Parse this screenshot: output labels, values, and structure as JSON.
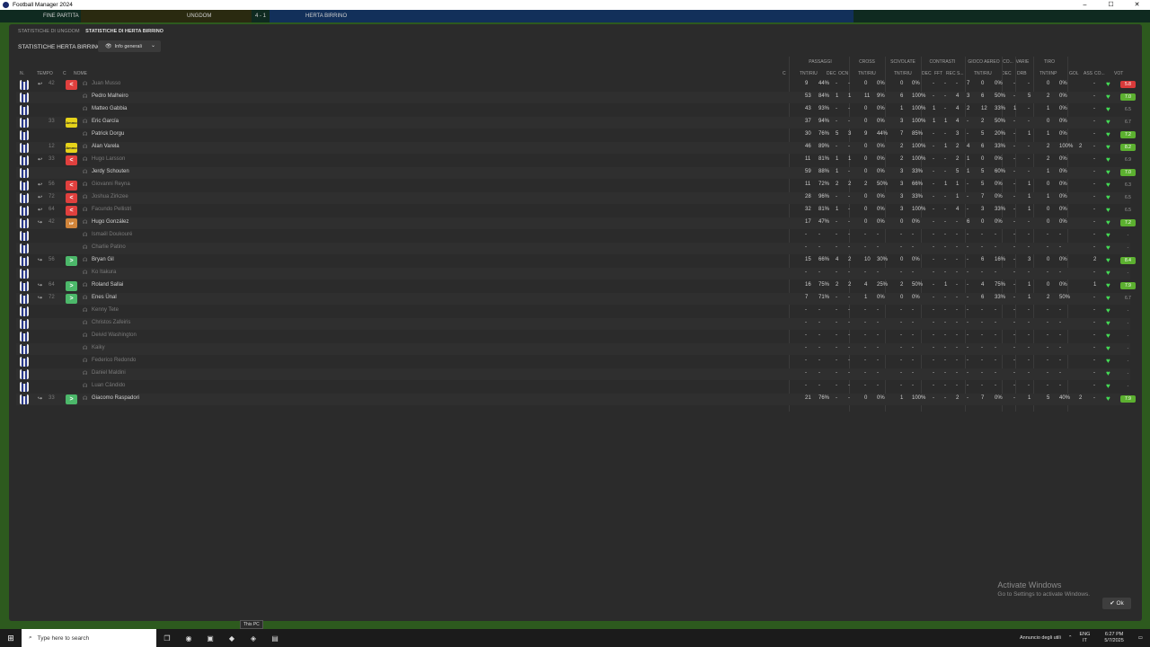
{
  "window": {
    "title": "Football Manager 2024",
    "controls": [
      "–",
      "☐",
      "✕"
    ]
  },
  "gamebar": {
    "status": "FINE PARTITA",
    "home": "UNGDOM",
    "score": "4 - 1",
    "away": "HERTA BIRRINO"
  },
  "breadcrumb": {
    "home_stats": "STATISTICHE DI UNGDOM",
    "away_stats": "STATISTICHE DI HERTA BIRRINO"
  },
  "panel_title": "STATISTICHE HERTA BIRRINO",
  "view_select": {
    "value": "Info generali",
    "icon": "eye-icon"
  },
  "group_headers": [
    "PASSAGGI",
    "CROSS",
    "SCIVOLATE",
    "CONTRASTI",
    "GIOCO AEREO",
    "CO...",
    "VARIE",
    "TIRO"
  ],
  "column_headers": {
    "num": "N.",
    "time": "TEMPO",
    "c": "C",
    "name": "NOME",
    "c2": "C",
    "pass_tnt": "TNT/RIU",
    "pass_dec": "DEC",
    "pass_ocn": "OCN",
    "cross": "TNT/RIU",
    "sciv": "TNT/RIU",
    "contr_dec": "DEC",
    "contr_fft": "FFT",
    "contr_rec": "REC",
    "contr_s": "S...",
    "aereo": "TNT/RIU",
    "co_dec": "DEC",
    "varie": "DRB",
    "tiro": "TNT/INP",
    "gol": "GOL",
    "ass": "ASS",
    "cond": "CO...",
    "vot": "VOT"
  },
  "players": [
    {
      "name": "Juan Musso",
      "time": "42",
      "sub": "↩",
      "pos": "<",
      "posc": "red",
      "p1": "9",
      "p2": "44%",
      "p3": "-",
      "p4": "-",
      "c1": "0",
      "c2": "0%",
      "s1": "0",
      "s2": "0%",
      "t1": "-",
      "t2": "-",
      "t3": "-",
      "t4": "7",
      "a1": "0",
      "a2": "0%",
      "d": "-",
      "v": "-",
      "ti1": "0",
      "ti2": "0%",
      "g": "",
      "as": "-",
      "vot": "5.8",
      "votc": "#d93a3a",
      "dim": true
    },
    {
      "name": "Pedro Malheiro",
      "time": "",
      "sub": "",
      "pos": "",
      "posc": "",
      "p1": "53",
      "p2": "84%",
      "p3": "1",
      "p4": "1",
      "c1": "11",
      "c2": "9%",
      "s1": "6",
      "s2": "100%",
      "t1": "-",
      "t2": "-",
      "t3": "4",
      "t4": "3",
      "a1": "6",
      "a2": "50%",
      "d": "-",
      "v": "5",
      "ti1": "2",
      "ti2": "0%",
      "g": "",
      "as": "-",
      "vot": "7.0",
      "votc": "#5cb030",
      "dim": false
    },
    {
      "name": "Matteo Gabbia",
      "time": "",
      "sub": "",
      "pos": "",
      "posc": "",
      "p1": "43",
      "p2": "93%",
      "p3": "-",
      "p4": "-",
      "c1": "0",
      "c2": "0%",
      "s1": "1",
      "s2": "100%",
      "t1": "1",
      "t2": "-",
      "t3": "4",
      "t4": "2",
      "a1": "12",
      "a2": "33%",
      "d": "1",
      "v": "-",
      "ti1": "1",
      "ti2": "0%",
      "g": "",
      "as": "-",
      "vot": "6.5",
      "votc": "",
      "dim": false
    },
    {
      "name": "Eric García",
      "time": "33",
      "sub": "",
      "pos": "Ammo",
      "posc": "ylw",
      "p1": "37",
      "p2": "94%",
      "p3": "-",
      "p4": "-",
      "c1": "0",
      "c2": "0%",
      "s1": "3",
      "s2": "100%",
      "t1": "1",
      "t2": "1",
      "t3": "4",
      "t4": "-",
      "a1": "2",
      "a2": "50%",
      "d": "-",
      "v": "-",
      "ti1": "0",
      "ti2": "0%",
      "g": "",
      "as": "-",
      "vot": "6.7",
      "votc": "",
      "dim": false
    },
    {
      "name": "Patrick Dorgu",
      "time": "",
      "sub": "",
      "pos": "",
      "posc": "",
      "p1": "30",
      "p2": "76%",
      "p3": "5",
      "p4": "3",
      "c1": "9",
      "c2": "44%",
      "s1": "7",
      "s2": "85%",
      "t1": "-",
      "t2": "-",
      "t3": "3",
      "t4": "-",
      "a1": "5",
      "a2": "20%",
      "d": "-",
      "v": "1",
      "ti1": "1",
      "ti2": "0%",
      "g": "",
      "as": "-",
      "vot": "7.2",
      "votc": "#5cb030",
      "dim": false
    },
    {
      "name": "Alan Varela",
      "time": "12",
      "sub": "",
      "pos": "Ammo",
      "posc": "ylw",
      "p1": "46",
      "p2": "89%",
      "p3": "-",
      "p4": "-",
      "c1": "0",
      "c2": "0%",
      "s1": "2",
      "s2": "100%",
      "t1": "-",
      "t2": "1",
      "t3": "2",
      "t4": "4",
      "a1": "6",
      "a2": "33%",
      "d": "-",
      "v": "-",
      "ti1": "2",
      "ti2": "100%",
      "g": "2",
      "as": "-",
      "vot": "8.2",
      "votc": "#5cb030",
      "dim": false
    },
    {
      "name": "Hugo Larsson",
      "time": "33",
      "sub": "↩",
      "pos": "<",
      "posc": "red",
      "p1": "11",
      "p2": "81%",
      "p3": "1",
      "p4": "1",
      "c1": "0",
      "c2": "0%",
      "s1": "2",
      "s2": "100%",
      "t1": "-",
      "t2": "-",
      "t3": "2",
      "t4": "1",
      "a1": "0",
      "a2": "0%",
      "d": "-",
      "v": "-",
      "ti1": "2",
      "ti2": "0%",
      "g": "",
      "as": "-",
      "vot": "6.9",
      "votc": "",
      "dim": true
    },
    {
      "name": "Jerdy Schouten",
      "time": "",
      "sub": "",
      "pos": "",
      "posc": "",
      "p1": "59",
      "p2": "88%",
      "p3": "1",
      "p4": "-",
      "c1": "0",
      "c2": "0%",
      "s1": "3",
      "s2": "33%",
      "t1": "-",
      "t2": "-",
      "t3": "5",
      "t4": "1",
      "a1": "5",
      "a2": "60%",
      "d": "-",
      "v": "-",
      "ti1": "1",
      "ti2": "0%",
      "g": "",
      "as": "-",
      "vot": "7.0",
      "votc": "#5cb030",
      "dim": false
    },
    {
      "name": "Giovanni Reyna",
      "time": "56",
      "sub": "↩",
      "pos": "<",
      "posc": "red",
      "p1": "11",
      "p2": "72%",
      "p3": "2",
      "p4": "2",
      "c1": "2",
      "c2": "50%",
      "s1": "3",
      "s2": "66%",
      "t1": "-",
      "t2": "1",
      "t3": "1",
      "t4": "-",
      "a1": "5",
      "a2": "0%",
      "d": "-",
      "v": "1",
      "ti1": "0",
      "ti2": "0%",
      "g": "",
      "as": "-",
      "vot": "6.3",
      "votc": "",
      "dim": true
    },
    {
      "name": "Joshua Zirkzee",
      "time": "72",
      "sub": "↩",
      "pos": "<",
      "posc": "red",
      "p1": "28",
      "p2": "96%",
      "p3": "-",
      "p4": "-",
      "c1": "0",
      "c2": "0%",
      "s1": "3",
      "s2": "33%",
      "t1": "-",
      "t2": "-",
      "t3": "1",
      "t4": "-",
      "a1": "7",
      "a2": "0%",
      "d": "-",
      "v": "1",
      "ti1": "1",
      "ti2": "0%",
      "g": "",
      "as": "-",
      "vot": "6.5",
      "votc": "",
      "dim": true
    },
    {
      "name": "Facundo Pellistri",
      "time": "64",
      "sub": "↩",
      "pos": "<",
      "posc": "red",
      "p1": "32",
      "p2": "81%",
      "p3": "1",
      "p4": "-",
      "c1": "0",
      "c2": "0%",
      "s1": "3",
      "s2": "100%",
      "t1": "-",
      "t2": "-",
      "t3": "4",
      "t4": "-",
      "a1": "3",
      "a2": "33%",
      "d": "-",
      "v": "1",
      "ti1": "0",
      "ti2": "0%",
      "g": "",
      "as": "-",
      "vot": "6.5",
      "votc": "",
      "dim": true
    },
    {
      "name": "Hugo González",
      "time": "42",
      "sub": "↪",
      "pos": "NF",
      "posc": "org",
      "p1": "17",
      "p2": "47%",
      "p3": "-",
      "p4": "-",
      "c1": "0",
      "c2": "0%",
      "s1": "0",
      "s2": "0%",
      "t1": "-",
      "t2": "-",
      "t3": "-",
      "t4": "6",
      "a1": "0",
      "a2": "0%",
      "d": "-",
      "v": "-",
      "ti1": "0",
      "ti2": "0%",
      "g": "",
      "as": "-",
      "vot": "7.2",
      "votc": "#5cb030",
      "dim": false
    },
    {
      "name": "Ismaël Doukouré",
      "time": "",
      "sub": "",
      "pos": "",
      "posc": "",
      "p1": "-",
      "p2": "-",
      "p3": "-",
      "p4": "-",
      "c1": "-",
      "c2": "-",
      "s1": "-",
      "s2": "-",
      "t1": "-",
      "t2": "-",
      "t3": "-",
      "t4": "-",
      "a1": "-",
      "a2": "-",
      "d": "-",
      "v": "-",
      "ti1": "-",
      "ti2": "-",
      "g": "",
      "as": "-",
      "vot": "-",
      "votc": "",
      "dim": true
    },
    {
      "name": "Charlie Patino",
      "time": "",
      "sub": "",
      "pos": "",
      "posc": "",
      "p1": "-",
      "p2": "-",
      "p3": "-",
      "p4": "-",
      "c1": "-",
      "c2": "-",
      "s1": "-",
      "s2": "-",
      "t1": "-",
      "t2": "-",
      "t3": "-",
      "t4": "-",
      "a1": "-",
      "a2": "-",
      "d": "-",
      "v": "-",
      "ti1": "-",
      "ti2": "-",
      "g": "",
      "as": "-",
      "vot": "-",
      "votc": "",
      "dim": true
    },
    {
      "name": "Bryan Gil",
      "time": "56",
      "sub": "↪",
      "pos": ">",
      "posc": "grn",
      "p1": "15",
      "p2": "66%",
      "p3": "4",
      "p4": "2",
      "c1": "10",
      "c2": "30%",
      "s1": "0",
      "s2": "0%",
      "t1": "-",
      "t2": "-",
      "t3": "-",
      "t4": "-",
      "a1": "6",
      "a2": "16%",
      "d": "-",
      "v": "3",
      "ti1": "0",
      "ti2": "0%",
      "g": "",
      "as": "2",
      "vot": "8.4",
      "votc": "#5cb030",
      "dim": false
    },
    {
      "name": "Ko Itakura",
      "time": "",
      "sub": "",
      "pos": "",
      "posc": "",
      "p1": "-",
      "p2": "-",
      "p3": "-",
      "p4": "-",
      "c1": "-",
      "c2": "-",
      "s1": "-",
      "s2": "-",
      "t1": "-",
      "t2": "-",
      "t3": "-",
      "t4": "-",
      "a1": "-",
      "a2": "-",
      "d": "-",
      "v": "-",
      "ti1": "-",
      "ti2": "-",
      "g": "",
      "as": "-",
      "vot": "-",
      "votc": "",
      "dim": true
    },
    {
      "name": "Roland Sallai",
      "time": "64",
      "sub": "↪",
      "pos": ">",
      "posc": "grn",
      "p1": "16",
      "p2": "75%",
      "p3": "2",
      "p4": "2",
      "c1": "4",
      "c2": "25%",
      "s1": "2",
      "s2": "50%",
      "t1": "-",
      "t2": "1",
      "t3": "-",
      "t4": "-",
      "a1": "4",
      "a2": "75%",
      "d": "-",
      "v": "1",
      "ti1": "0",
      "ti2": "0%",
      "g": "",
      "as": "1",
      "vot": "7.9",
      "votc": "#5cb030",
      "dim": false
    },
    {
      "name": "Enes Ünal",
      "time": "72",
      "sub": "↪",
      "pos": ">",
      "posc": "grn",
      "p1": "7",
      "p2": "71%",
      "p3": "-",
      "p4": "-",
      "c1": "1",
      "c2": "0%",
      "s1": "0",
      "s2": "0%",
      "t1": "-",
      "t2": "-",
      "t3": "-",
      "t4": "-",
      "a1": "6",
      "a2": "33%",
      "d": "-",
      "v": "1",
      "ti1": "2",
      "ti2": "50%",
      "g": "",
      "as": "-",
      "vot": "6.7",
      "votc": "",
      "dim": false
    },
    {
      "name": "Kenny Tete",
      "time": "",
      "sub": "",
      "pos": "",
      "posc": "",
      "p1": "-",
      "p2": "-",
      "p3": "-",
      "p4": "-",
      "c1": "-",
      "c2": "-",
      "s1": "-",
      "s2": "-",
      "t1": "-",
      "t2": "-",
      "t3": "-",
      "t4": "-",
      "a1": "-",
      "a2": "-",
      "d": "-",
      "v": "-",
      "ti1": "-",
      "ti2": "-",
      "g": "",
      "as": "-",
      "vot": "-",
      "votc": "",
      "dim": true
    },
    {
      "name": "Christos Zafeiris",
      "time": "",
      "sub": "",
      "pos": "",
      "posc": "",
      "p1": "-",
      "p2": "-",
      "p3": "-",
      "p4": "-",
      "c1": "-",
      "c2": "-",
      "s1": "-",
      "s2": "-",
      "t1": "-",
      "t2": "-",
      "t3": "-",
      "t4": "-",
      "a1": "-",
      "a2": "-",
      "d": "-",
      "v": "-",
      "ti1": "-",
      "ti2": "-",
      "g": "",
      "as": "-",
      "vot": "-",
      "votc": "",
      "dim": true
    },
    {
      "name": "Deivid Washington",
      "time": "",
      "sub": "",
      "pos": "",
      "posc": "",
      "p1": "-",
      "p2": "-",
      "p3": "-",
      "p4": "-",
      "c1": "-",
      "c2": "-",
      "s1": "-",
      "s2": "-",
      "t1": "-",
      "t2": "-",
      "t3": "-",
      "t4": "-",
      "a1": "-",
      "a2": "-",
      "d": "-",
      "v": "-",
      "ti1": "-",
      "ti2": "-",
      "g": "",
      "as": "-",
      "vot": "-",
      "votc": "",
      "dim": true
    },
    {
      "name": "Kaiky",
      "time": "",
      "sub": "",
      "pos": "",
      "posc": "",
      "p1": "-",
      "p2": "-",
      "p3": "-",
      "p4": "-",
      "c1": "-",
      "c2": "-",
      "s1": "-",
      "s2": "-",
      "t1": "-",
      "t2": "-",
      "t3": "-",
      "t4": "-",
      "a1": "-",
      "a2": "-",
      "d": "-",
      "v": "-",
      "ti1": "-",
      "ti2": "-",
      "g": "",
      "as": "-",
      "vot": "-",
      "votc": "",
      "dim": true
    },
    {
      "name": "Federico Redondo",
      "time": "",
      "sub": "",
      "pos": "",
      "posc": "",
      "p1": "-",
      "p2": "-",
      "p3": "-",
      "p4": "-",
      "c1": "-",
      "c2": "-",
      "s1": "-",
      "s2": "-",
      "t1": "-",
      "t2": "-",
      "t3": "-",
      "t4": "-",
      "a1": "-",
      "a2": "-",
      "d": "-",
      "v": "-",
      "ti1": "-",
      "ti2": "-",
      "g": "",
      "as": "-",
      "vot": "-",
      "votc": "",
      "dim": true
    },
    {
      "name": "Daniel Maldini",
      "time": "",
      "sub": "",
      "pos": "",
      "posc": "",
      "p1": "-",
      "p2": "-",
      "p3": "-",
      "p4": "-",
      "c1": "-",
      "c2": "-",
      "s1": "-",
      "s2": "-",
      "t1": "-",
      "t2": "-",
      "t3": "-",
      "t4": "-",
      "a1": "-",
      "a2": "-",
      "d": "-",
      "v": "-",
      "ti1": "-",
      "ti2": "-",
      "g": "",
      "as": "-",
      "vot": "-",
      "votc": "",
      "dim": true
    },
    {
      "name": "Luan Cândido",
      "time": "",
      "sub": "",
      "pos": "",
      "posc": "",
      "p1": "-",
      "p2": "-",
      "p3": "-",
      "p4": "-",
      "c1": "-",
      "c2": "-",
      "s1": "-",
      "s2": "-",
      "t1": "-",
      "t2": "-",
      "t3": "-",
      "t4": "-",
      "a1": "-",
      "a2": "-",
      "d": "-",
      "v": "-",
      "ti1": "-",
      "ti2": "-",
      "g": "",
      "as": "-",
      "vot": "-",
      "votc": "",
      "dim": true
    },
    {
      "name": "Giacomo Raspadori",
      "time": "33",
      "sub": "↪",
      "pos": ">",
      "posc": "grn",
      "p1": "21",
      "p2": "76%",
      "p3": "-",
      "p4": "-",
      "c1": "0",
      "c2": "0%",
      "s1": "1",
      "s2": "100%",
      "t1": "-",
      "t2": "-",
      "t3": "2",
      "t4": "-",
      "a1": "7",
      "a2": "0%",
      "d": "-",
      "v": "1",
      "ti1": "5",
      "ti2": "40%",
      "g": "2",
      "as": "-",
      "vot": "7.9",
      "votc": "#5cb030",
      "dim": false
    }
  ],
  "ok_button": "Ok",
  "watermark": {
    "line1": "Activate Windows",
    "line2": "Go to Settings to activate Windows."
  },
  "taskbar": {
    "search_placeholder": "Type here to search",
    "tooltip": "This PC",
    "news": "Annuncio degli utili",
    "lang1": "ENG",
    "lang2": "IT",
    "time": "6:27 PM",
    "date": "5/7/2025"
  }
}
